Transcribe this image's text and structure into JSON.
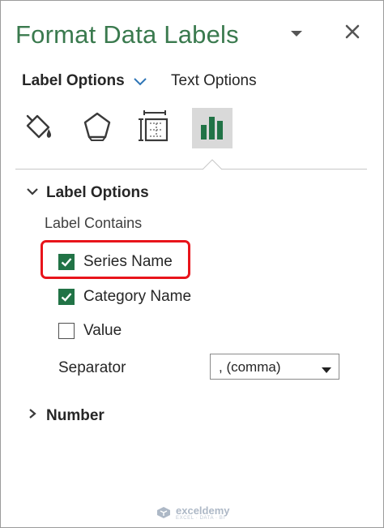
{
  "pane": {
    "title": "Format Data Labels"
  },
  "tabs": {
    "label_options": "Label Options",
    "text_options": "Text Options"
  },
  "toolbar_icons": [
    "fill-line-icon",
    "effects-icon",
    "size-properties-icon",
    "label-options-chart-icon"
  ],
  "label_options_section": {
    "heading": "Label Options",
    "label_contains": "Label Contains",
    "checkboxes": [
      {
        "label": "Series Name",
        "checked": true
      },
      {
        "label": "Category Name",
        "checked": true
      },
      {
        "label": "Value",
        "checked": false
      }
    ],
    "separator_label": "Separator",
    "separator_value": ", (comma)"
  },
  "number_section": {
    "heading": "Number"
  },
  "watermark": {
    "brand": "exceldemy",
    "tagline": "EXCEL · DATA · BI"
  },
  "colors": {
    "title_green": "#3a7a4e",
    "checkbox_green": "#217346",
    "highlight_red": "#e8141b"
  }
}
